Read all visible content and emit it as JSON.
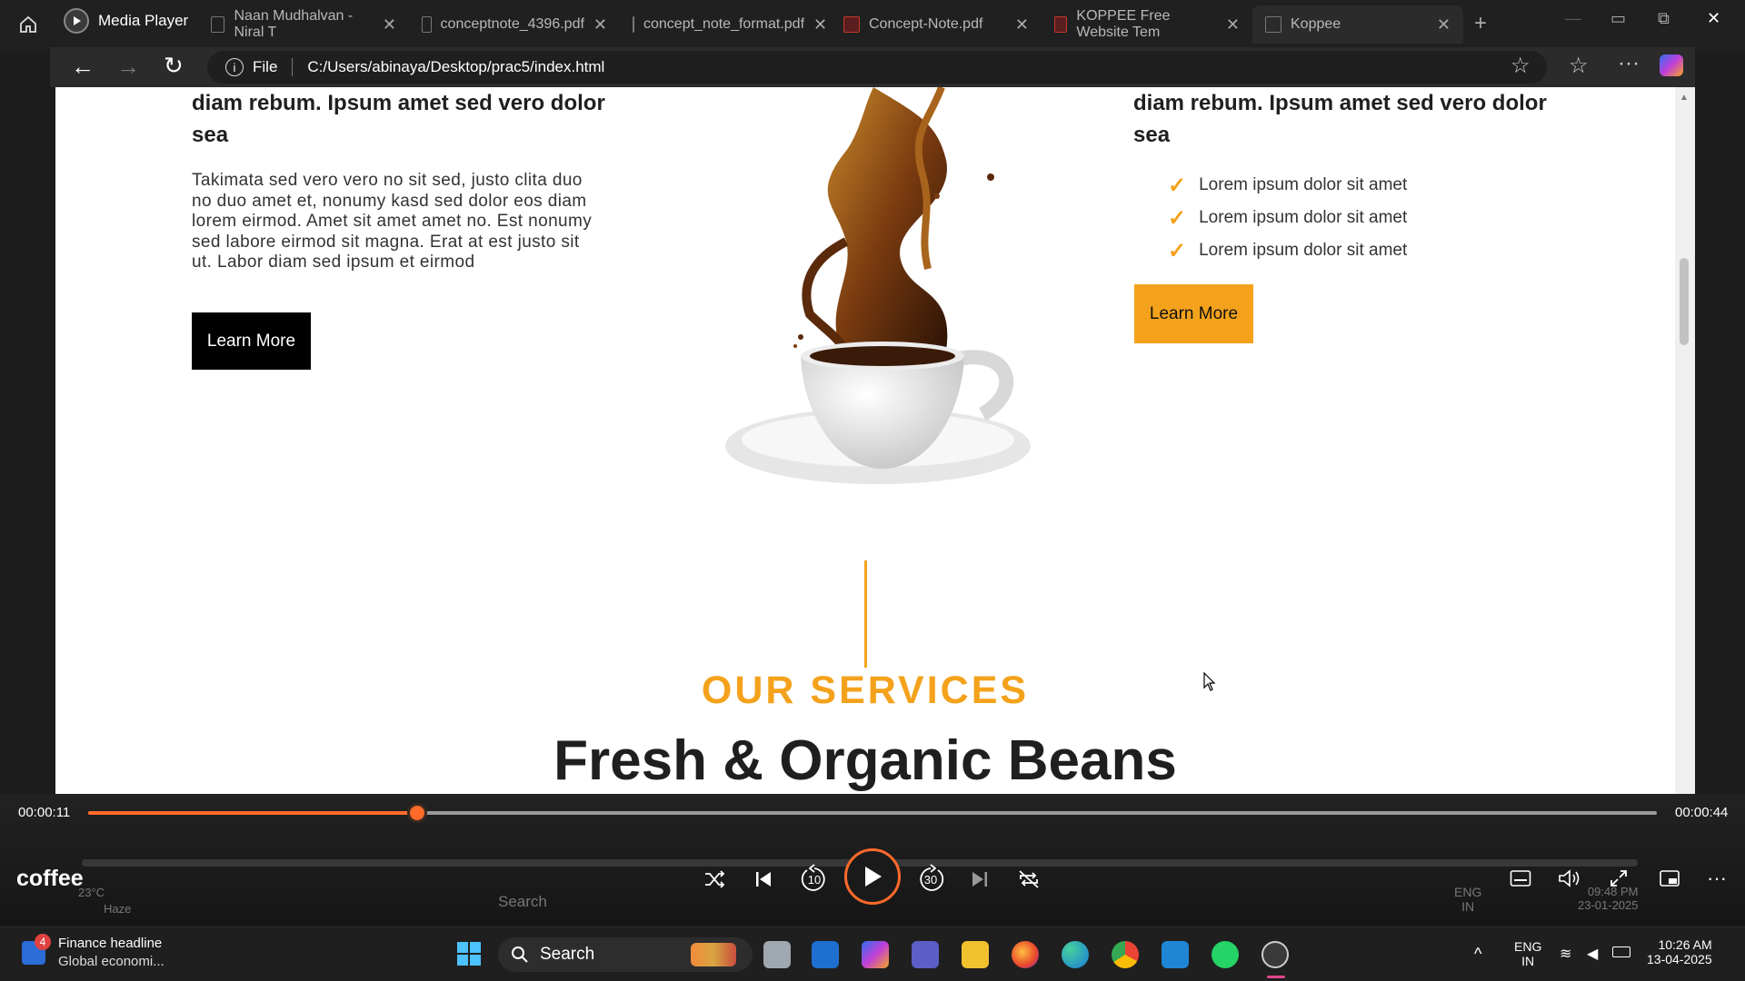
{
  "titlebar": {
    "app_name": "Media Player",
    "tabs": [
      {
        "label": "Naan Mudhalvan - Niral T"
      },
      {
        "label": "conceptnote_4396.pdf"
      },
      {
        "label": "concept_note_format.pdf"
      },
      {
        "label": "Concept-Note.pdf"
      },
      {
        "label": "KOPPEE Free Website Tem"
      },
      {
        "label": "Koppee"
      }
    ]
  },
  "browser": {
    "protocol_label": "File",
    "url": "C:/Users/abinaya/Desktop/prac5/index.html"
  },
  "webpage": {
    "left_col": {
      "heading_line1": "diam rebum. Ipsum amet sed vero dolor",
      "heading_line2": "sea",
      "body": "Takimata sed vero vero no sit sed, justo clita duo no duo amet et, nonumy kasd sed dolor eos diam lorem eirmod. Amet sit amet amet no. Est nonumy sed labore eirmod sit magna. Erat at est justo sit ut. Labor diam sed ipsum et eirmod",
      "button": "Learn More"
    },
    "right_col": {
      "heading_line1": "diam rebum. Ipsum amet sed vero dolor",
      "heading_line2": "sea",
      "checklist": [
        "Lorem ipsum dolor sit amet",
        "Lorem ipsum dolor sit amet",
        "Lorem ipsum dolor sit amet"
      ],
      "check_mark": "✓",
      "button": "Learn More"
    },
    "services": {
      "eyebrow": "OUR SERVICES",
      "title": "Fresh & Organic Beans"
    },
    "colors": {
      "accent": "#f4a21c",
      "dark_button": "#000000"
    }
  },
  "media_player": {
    "elapsed": "00:00:11",
    "duration": "00:00:44",
    "progress": 0.21,
    "media_title": "coffee",
    "controls": [
      "shuffle-icon",
      "previous-icon",
      "rewind-10-icon",
      "play-icon",
      "forward-30-icon",
      "next-icon",
      "repeat-icon"
    ],
    "rewind_label": "10",
    "forward_label": "30",
    "right_controls": [
      "captions-icon",
      "volume-icon",
      "fullscreen-icon",
      "miniplayer-icon",
      "more-icon"
    ],
    "colors": {
      "progress": "#ff6a2b"
    }
  },
  "ghost_taskbar": {
    "temperature": "23°C",
    "condition": "Haze",
    "search": "Search",
    "lang_line1": "ENG",
    "lang_line2": "IN",
    "time": "09:48 PM",
    "date": "23-01-2025"
  },
  "taskbar": {
    "news_badge": "4",
    "news_title": "Finance headline",
    "news_sub": "Global economi...",
    "search_label": "Search",
    "lang_line1": "ENG",
    "lang_line2": "IN",
    "time": "10:26 AM",
    "date": "13-04-2025"
  }
}
